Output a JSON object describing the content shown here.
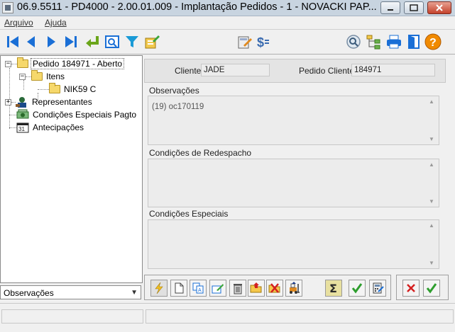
{
  "window": {
    "title": "06.9.5511 - PD4000 - 2.00.01.009 - Implantação Pedidos - 1 - NOVACKI PAP..."
  },
  "menu": {
    "items": [
      {
        "label": "Arquivo",
        "accel": "A"
      },
      {
        "label": "Ajuda",
        "accel": "A"
      }
    ]
  },
  "toolbar": {
    "left_icons": [
      "first-record-icon",
      "previous-record-icon",
      "next-record-icon",
      "last-record-icon",
      "return-icon",
      "preview-icon",
      "filter-icon",
      "edit-form-icon"
    ],
    "middle_icons": [
      "calculator-edit-icon",
      "currency-icon"
    ],
    "right_icons": [
      "search-icon",
      "tree-structure-icon",
      "print-icon",
      "exit-door-icon",
      "help-icon"
    ]
  },
  "tree": {
    "nodes": [
      {
        "label": "Pedido 184971 - Aberto",
        "icon": "folder-icon",
        "level": 0,
        "expander": "minus",
        "selected": true
      },
      {
        "label": "Itens",
        "icon": "folder-icon",
        "level": 1,
        "expander": "minus"
      },
      {
        "label": "NIK59 C",
        "icon": "folder-icon",
        "level": 2
      },
      {
        "label": "Representantes",
        "icon": "sales-rep-icon",
        "level": 0,
        "expander": "plus"
      },
      {
        "label": "Condições Especiais Pagto",
        "icon": "money-icon",
        "level": 0
      },
      {
        "label": "Antecipações",
        "icon": "calendar-icon",
        "level": 0
      }
    ]
  },
  "select": {
    "value": "Observações"
  },
  "header": {
    "cliente_label": "Cliente:",
    "cliente_value": "JADE",
    "pedido_cliente_label": "Pedido Cliente:",
    "pedido_cliente_value": "184971"
  },
  "sections": {
    "observacoes": {
      "label": "Observações",
      "text": "(19)  oc170119"
    },
    "redespacho": {
      "label": "Condições de Redespacho",
      "text": ""
    },
    "especiais": {
      "label": "Condições Especiais",
      "text": ""
    }
  },
  "action_buttons": {
    "left": [
      "lightning-icon",
      "new-document-icon",
      "copy-text-icon",
      "edit-pen-icon",
      "delete-trash-icon",
      "open-folder-icon",
      "cancel-folder-icon",
      "forklift-icon",
      "sum-icon",
      "confirm-check-icon",
      "calculator-icon"
    ],
    "right": [
      "cancel-x-icon",
      "ok-check-icon"
    ]
  },
  "colors": {
    "accent_blue": "#1a6fd6",
    "check_green": "#2e9e2e",
    "cancel_red": "#d42020",
    "help_orange": "#f08a00"
  }
}
